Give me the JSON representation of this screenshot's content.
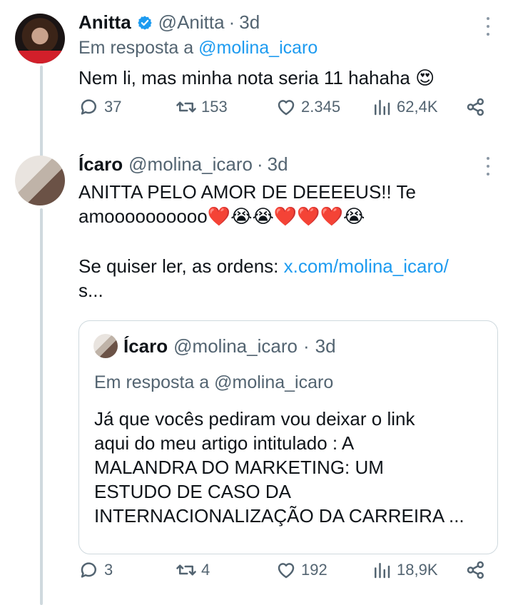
{
  "tweet1": {
    "name": "Anitta",
    "handle": "@Anitta",
    "dot": "·",
    "time": "3d",
    "reply_prefix": "Em resposta a",
    "reply_mention": "@molina_icaro",
    "text": "Nem li, mas minha nota seria 11 hahaha 😍",
    "replies": "37",
    "retweets": "153",
    "likes": "2.345",
    "views": "62,4K"
  },
  "tweet2": {
    "name": "Ícaro",
    "handle": "@molina_icaro",
    "dot": "·",
    "time": "3d",
    "line1": "ANITTA PELO AMOR DE DEEEEUS!! Te",
    "line2": "amoooooooooo❤️😭😭❤️❤️❤️😭",
    "link_prefix": "Se quiser ler, as ordens: ",
    "link_part1": "x.com/molina_icaro/",
    "link_part2": "s...",
    "replies": "3",
    "retweets": "4",
    "likes": "192",
    "views": "18,9K"
  },
  "quote": {
    "name": "Ícaro",
    "handle": "@molina_icaro",
    "dot": "·",
    "time": "3d",
    "reply_prefix": "Em resposta a @molina_icaro",
    "line1": "Já que vocês pediram vou deixar o link",
    "line2": "aqui do meu artigo intitulado : A",
    "line3": "MALANDRA DO MARKETING: UM",
    "line4": "ESTUDO DE CASO DA",
    "line5": "INTERNACIONALIZAÇÃO DA CARREIRA ..."
  },
  "colors": {
    "accent": "#1d9bf0",
    "muted": "#536471",
    "border": "#cfd9de"
  },
  "icons": [
    "verified-badge-icon",
    "more-options-icon",
    "reply-icon",
    "retweet-icon",
    "like-icon",
    "views-icon",
    "share-icon"
  ]
}
